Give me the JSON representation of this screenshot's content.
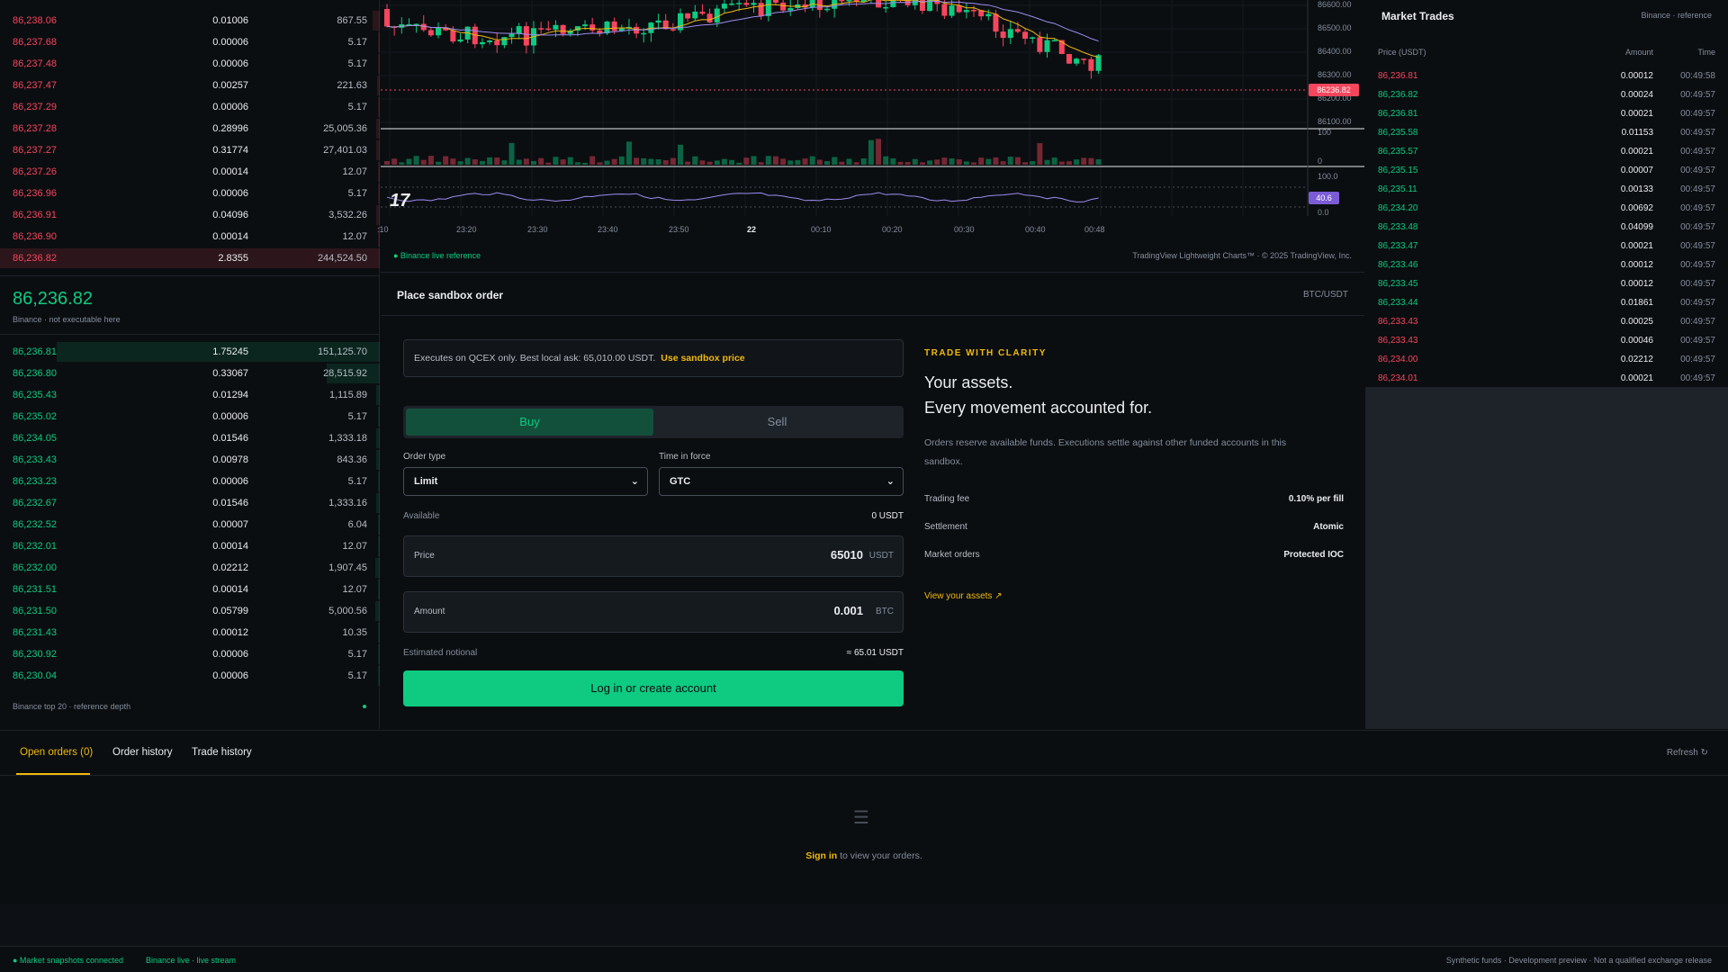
{
  "orderbook": {
    "asks": [
      {
        "price": "86,238.06",
        "amount": "0.01006",
        "total": "867.55",
        "depth": 0.02
      },
      {
        "price": "86,237.68",
        "amount": "0.00006",
        "total": "5.17",
        "depth": 0.005
      },
      {
        "price": "86,237.48",
        "amount": "0.00006",
        "total": "5.17",
        "depth": 0.005
      },
      {
        "price": "86,237.47",
        "amount": "0.00257",
        "total": "221.63",
        "depth": 0.008
      },
      {
        "price": "86,237.29",
        "amount": "0.00006",
        "total": "5.17",
        "depth": 0.005
      },
      {
        "price": "86,237.28",
        "amount": "0.28996",
        "total": "25,005.36",
        "depth": 0.01
      },
      {
        "price": "86,237.27",
        "amount": "0.31774",
        "total": "27,401.03",
        "depth": 0.01
      },
      {
        "price": "86,237.26",
        "amount": "0.00014",
        "total": "12.07",
        "depth": 0.005
      },
      {
        "price": "86,236.96",
        "amount": "0.00006",
        "total": "5.17",
        "depth": 0.005
      },
      {
        "price": "86,236.91",
        "amount": "0.04096",
        "total": "3,532.26",
        "depth": 0.01
      },
      {
        "price": "86,236.90",
        "amount": "0.00014",
        "total": "12.07",
        "depth": 0.005
      },
      {
        "price": "86,236.82",
        "amount": "2.8355",
        "total": "244,524.50",
        "depth": 1.0
      }
    ],
    "mid_price": "86,236.82",
    "mid_sub": "Binance · not executable here",
    "bids": [
      {
        "price": "86,236.81",
        "amount": "1.75245",
        "total": "151,125.70",
        "depth": 0.85
      },
      {
        "price": "86,236.80",
        "amount": "0.33067",
        "total": "28,515.92",
        "depth": 0.14
      },
      {
        "price": "86,235.43",
        "amount": "0.01294",
        "total": "1,115.89",
        "depth": 0.01
      },
      {
        "price": "86,235.02",
        "amount": "0.00006",
        "total": "5.17",
        "depth": 0.005
      },
      {
        "price": "86,234.05",
        "amount": "0.01546",
        "total": "1,333.18",
        "depth": 0.01
      },
      {
        "price": "86,233.43",
        "amount": "0.00978",
        "total": "843.36",
        "depth": 0.01
      },
      {
        "price": "86,233.23",
        "amount": "0.00006",
        "total": "5.17",
        "depth": 0.005
      },
      {
        "price": "86,232.67",
        "amount": "0.01546",
        "total": "1,333.16",
        "depth": 0.01
      },
      {
        "price": "86,232.52",
        "amount": "0.00007",
        "total": "6.04",
        "depth": 0.005
      },
      {
        "price": "86,232.01",
        "amount": "0.00014",
        "total": "12.07",
        "depth": 0.005
      },
      {
        "price": "86,232.00",
        "amount": "0.02212",
        "total": "1,907.45",
        "depth": 0.012
      },
      {
        "price": "86,231.51",
        "amount": "0.00014",
        "total": "12.07",
        "depth": 0.005
      },
      {
        "price": "86,231.50",
        "amount": "0.05799",
        "total": "5,000.56",
        "depth": 0.012
      },
      {
        "price": "86,231.43",
        "amount": "0.00012",
        "total": "10.35",
        "depth": 0.005
      },
      {
        "price": "86,230.92",
        "amount": "0.00006",
        "total": "5.17",
        "depth": 0.005
      },
      {
        "price": "86,230.04",
        "amount": "0.00006",
        "total": "5.17",
        "depth": 0.005
      }
    ],
    "footer": "Binance top 20 · reference depth"
  },
  "chart": {
    "price_axis": [
      "86600.00",
      "86500.00",
      "86400.00",
      "86300.00",
      "86200.00",
      "86100.00"
    ],
    "last_price": "86236.82",
    "volume_axis": [
      "100",
      "0"
    ],
    "rsi_axis": [
      "100.0",
      "0.0"
    ],
    "rsi_value": "40.6",
    "time_axis": [
      ":10",
      "23:20",
      "23:30",
      "23:40",
      "23:50",
      "22",
      "00:10",
      "00:20",
      "00:30",
      "00:40",
      "00:48"
    ],
    "source_label": "● Binance live reference",
    "attribution": "TradingView Lightweight Charts™ · © 2025 TradingView, Inc.",
    "logo_text": "17",
    "colors": {
      "up": "#0ecb81",
      "down": "#f6465d",
      "ma_fast": "#f0b90b",
      "ma_slow": "#9b8cf0",
      "rsi": "#9b8cf0"
    }
  },
  "order": {
    "title": "Place sandbox order",
    "pair": "BTC/USDT",
    "notice_text": "Executes on QCEX only. Best local ask: 65,010.00 USDT.",
    "notice_link": "Use sandbox price",
    "buy_label": "Buy",
    "sell_label": "Sell",
    "order_type_label": "Order type",
    "order_type_value": "Limit",
    "tif_label": "Time in force",
    "tif_value": "GTC",
    "available_label": "Available",
    "available_value": "0 USDT",
    "price_label": "Price",
    "price_value": "65010",
    "price_unit": "USDT",
    "amount_label": "Amount",
    "amount_value": "0.001",
    "amount_unit": "BTC",
    "notional_label": "Estimated notional",
    "notional_value": "≈ 65.01 USDT",
    "submit_label": "Log in or create account"
  },
  "promo": {
    "tag": "TRADE WITH CLARITY",
    "headline_1": "Your assets.",
    "headline_2": "Every movement accounted for.",
    "description": "Orders reserve available funds. Executions settle against other funded accounts in this sandbox.",
    "rows": [
      {
        "key": "Trading fee",
        "value": "0.10% per fill"
      },
      {
        "key": "Settlement",
        "value": "Atomic"
      },
      {
        "key": "Market orders",
        "value": "Protected IOC"
      }
    ],
    "link": "View your assets ↗"
  },
  "trades": {
    "title": "Market Trades",
    "source": "Binance · reference",
    "headers": {
      "price": "Price (USDT)",
      "amount": "Amount",
      "time": "Time"
    },
    "rows": [
      {
        "price": "86,236.81",
        "amount": "0.00012",
        "time": "00:49:58",
        "side": "sell"
      },
      {
        "price": "86,236.82",
        "amount": "0.00024",
        "time": "00:49:57",
        "side": "buy"
      },
      {
        "price": "86,236.81",
        "amount": "0.00021",
        "time": "00:49:57",
        "side": "buy"
      },
      {
        "price": "86,235.58",
        "amount": "0.01153",
        "time": "00:49:57",
        "side": "buy"
      },
      {
        "price": "86,235.57",
        "amount": "0.00021",
        "time": "00:49:57",
        "side": "buy"
      },
      {
        "price": "86,235.15",
        "amount": "0.00007",
        "time": "00:49:57",
        "side": "buy"
      },
      {
        "price": "86,235.11",
        "amount": "0.00133",
        "time": "00:49:57",
        "side": "buy"
      },
      {
        "price": "86,234.20",
        "amount": "0.00692",
        "time": "00:49:57",
        "side": "buy"
      },
      {
        "price": "86,233.48",
        "amount": "0.04099",
        "time": "00:49:57",
        "side": "buy"
      },
      {
        "price": "86,233.47",
        "amount": "0.00021",
        "time": "00:49:57",
        "side": "buy"
      },
      {
        "price": "86,233.46",
        "amount": "0.00012",
        "time": "00:49:57",
        "side": "buy"
      },
      {
        "price": "86,233.45",
        "amount": "0.00012",
        "time": "00:49:57",
        "side": "buy"
      },
      {
        "price": "86,233.44",
        "amount": "0.01861",
        "time": "00:49:57",
        "side": "buy"
      },
      {
        "price": "86,233.43",
        "amount": "0.00025",
        "time": "00:49:57",
        "side": "sell"
      },
      {
        "price": "86,233.43",
        "amount": "0.00046",
        "time": "00:49:57",
        "side": "sell"
      },
      {
        "price": "86,234.00",
        "amount": "0.02212",
        "time": "00:49:57",
        "side": "sell"
      },
      {
        "price": "86,234.01",
        "amount": "0.00021",
        "time": "00:49:57",
        "side": "sell"
      }
    ]
  },
  "bottom": {
    "tabs": [
      "Open orders (0)",
      "Order history",
      "Trade history"
    ],
    "refresh": "Refresh ↻",
    "empty_icon": "☰",
    "signin_link": "Sign in",
    "signin_rest": " to view your orders."
  },
  "status": {
    "left_1": "● Market snapshots connected",
    "left_2": "Binance live · live stream",
    "right": "Synthetic funds · Development preview · Not a qualified exchange release"
  }
}
